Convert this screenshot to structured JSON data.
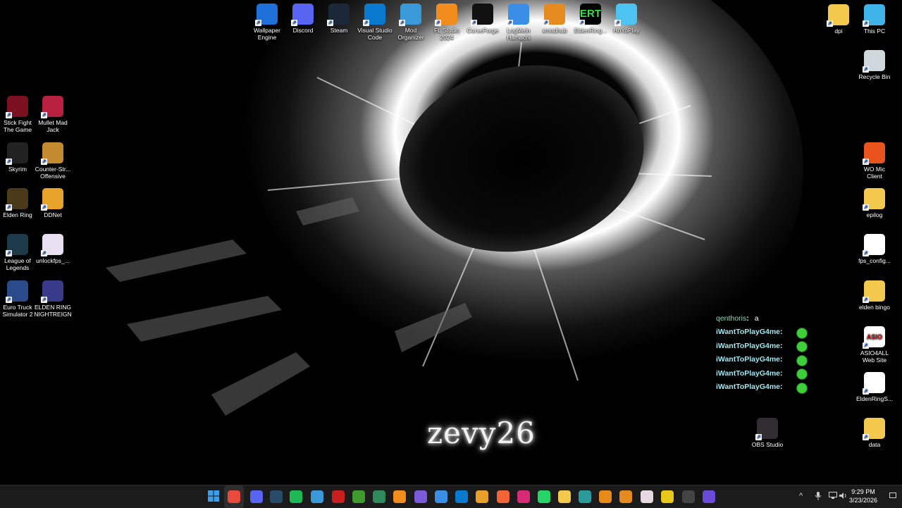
{
  "desktop": {
    "top_icons": [
      {
        "label": "Wallpaper Engine",
        "icon": "wallpaper-engine-icon",
        "color": "#1e6fd9"
      },
      {
        "label": "Discord",
        "icon": "discord-icon",
        "color": "#5865f2"
      },
      {
        "label": "Steam",
        "icon": "steam-icon",
        "color": "#1b2838"
      },
      {
        "label": "Visual Studio Code",
        "icon": "vscode-icon",
        "color": "#0a7ad1"
      },
      {
        "label": "Mod Organizer",
        "icon": "mod-organizer-icon",
        "color": "#3a9ad9"
      },
      {
        "label": "FL Studio 2024",
        "icon": "fl-studio-icon",
        "color": "#f28c1c"
      },
      {
        "label": "CurseForge",
        "icon": "curseforge-icon",
        "color": "#111111"
      },
      {
        "label": "LogMeIn Hamachi",
        "icon": "hamachi-icon",
        "color": "#3a8ee6"
      },
      {
        "label": "xmodhub",
        "icon": "xmodhub-icon",
        "color": "#e58a1f"
      },
      {
        "label": "EldenRing...",
        "icon": "ert-icon",
        "color": "#000000"
      },
      {
        "label": "HoYoPlay",
        "icon": "hoyoplay-icon",
        "color": "#4cc3f0"
      }
    ],
    "ert_text": "ERT",
    "left_icons": [
      {
        "label": "Stick Fight The Game",
        "icon": "stick-fight-icon",
        "color": "#7a1020"
      },
      {
        "label": "Mullet Mad Jack",
        "icon": "mullet-mad-jack-icon",
        "color": "#b82040"
      },
      {
        "label": "Skyrim",
        "icon": "skyrim-icon",
        "color": "#222222"
      },
      {
        "label": "Counter-Str... Offensive",
        "icon": "counter-strike-icon",
        "color": "#c48a30"
      },
      {
        "label": "Elden Ring",
        "icon": "elden-ring-icon",
        "color": "#4a3a1a"
      },
      {
        "label": "DDNet",
        "icon": "ddnet-icon",
        "color": "#e8a32a"
      },
      {
        "label": "League of Legends",
        "icon": "league-of-legends-icon",
        "color": "#1c3a4a"
      },
      {
        "label": "unlockfps_...",
        "icon": "unlockfps-icon",
        "color": "#e8e0f0"
      },
      {
        "label": "Euro Truck Simulator 2",
        "icon": "euro-truck-icon",
        "color": "#2a4a8a"
      },
      {
        "label": "ELDEN RING NIGHTREIGN",
        "icon": "nightreign-icon",
        "color": "#3a3a8a"
      }
    ],
    "right_icons": [
      {
        "label": "dpi",
        "icon": "folder-icon",
        "color": "#f2c94c"
      },
      {
        "label": "This PC",
        "icon": "monitor-icon",
        "color": "#3fb4e8"
      },
      {
        "label": "Recycle Bin",
        "icon": "recycle-bin-icon",
        "color": "#cfd8dc"
      },
      {
        "label": "WO Mic Client",
        "icon": "microphone-icon",
        "color": "#e8541c"
      },
      {
        "label": "epilog",
        "icon": "folder-icon",
        "color": "#f2c94c"
      },
      {
        "label": "fps_config...",
        "icon": "json-file-icon",
        "color": "#ffffff"
      },
      {
        "label": "elden bingo",
        "icon": "folder-icon",
        "color": "#f2c94c"
      },
      {
        "label": "ASIO4ALL Web Site",
        "icon": "asio-icon",
        "color": "#ffffff"
      },
      {
        "label": "EldenRingS...",
        "icon": "app-window-icon",
        "color": "#ffffff"
      },
      {
        "label": "OBS Studio",
        "icon": "obs-icon",
        "color": "#302e31"
      },
      {
        "label": "data",
        "icon": "folder-icon",
        "color": "#f2c94c"
      }
    ],
    "asio_text": "ASIO"
  },
  "chat": {
    "messages": [
      {
        "user": "qenthoris",
        "text": "a"
      },
      {
        "user": "iWantToPlayG4me",
        "text": ""
      },
      {
        "user": "iWantToPlayG4me",
        "text": ""
      },
      {
        "user": "iWantToPlayG4me",
        "text": ""
      },
      {
        "user": "iWantToPlayG4me",
        "text": ""
      },
      {
        "user": "iWantToPlayG4me",
        "text": ""
      }
    ],
    "colon": ":"
  },
  "streamer_name": "zevy26",
  "taskbar": {
    "apps": [
      {
        "name": "start-button",
        "icon": "windows-icon",
        "color": "#3a9ee8"
      },
      {
        "name": "taskbar-chrome",
        "icon": "chrome-icon",
        "color": "#e84a3c"
      },
      {
        "name": "taskbar-discord",
        "icon": "discord-icon",
        "color": "#5865f2"
      },
      {
        "name": "taskbar-steam",
        "icon": "steam-icon",
        "color": "#2a4a6a"
      },
      {
        "name": "taskbar-spotify",
        "icon": "spotify-icon",
        "color": "#1db954"
      },
      {
        "name": "taskbar-mod-organizer",
        "icon": "mod-organizer-icon",
        "color": "#3a9ad9"
      },
      {
        "name": "taskbar-app-red",
        "icon": "red-app-icon",
        "color": "#c81e1e"
      },
      {
        "name": "taskbar-minecraft",
        "icon": "minecraft-icon",
        "color": "#3f9a2e"
      },
      {
        "name": "taskbar-app-green",
        "icon": "green-app-icon",
        "color": "#2e8a5a"
      },
      {
        "name": "taskbar-fl-studio",
        "icon": "fl-studio-icon",
        "color": "#f28c1c"
      },
      {
        "name": "taskbar-app-purple",
        "icon": "purple-app-icon",
        "color": "#7a5ad9"
      },
      {
        "name": "taskbar-hamachi",
        "icon": "hamachi-icon",
        "color": "#3a8ee6"
      },
      {
        "name": "taskbar-vscode",
        "icon": "vscode-icon",
        "color": "#0a7ad1"
      },
      {
        "name": "taskbar-app-orange",
        "icon": "orange-app-icon",
        "color": "#e8a02a"
      },
      {
        "name": "taskbar-curseforge",
        "icon": "curseforge-icon",
        "color": "#f16436"
      },
      {
        "name": "taskbar-instagram",
        "icon": "instagram-icon",
        "color": "#d62976"
      },
      {
        "name": "taskbar-whatsapp",
        "icon": "whatsapp-icon",
        "color": "#25d366"
      },
      {
        "name": "taskbar-file-explorer",
        "icon": "folder-icon",
        "color": "#f2c94c"
      },
      {
        "name": "taskbar-app-teal",
        "icon": "teal-app-icon",
        "color": "#2a9a9a"
      },
      {
        "name": "taskbar-app-amber",
        "icon": "amber-app-icon",
        "color": "#e88a1a"
      },
      {
        "name": "taskbar-xmodhub",
        "icon": "xmodhub-icon",
        "color": "#e58a1f"
      },
      {
        "name": "taskbar-app-anime",
        "icon": "anime-app-icon",
        "color": "#e8d8e0"
      },
      {
        "name": "taskbar-app-yellow",
        "icon": "yellow-app-icon",
        "color": "#e8c81a"
      },
      {
        "name": "taskbar-obs",
        "icon": "obs-icon",
        "color": "#444444"
      },
      {
        "name": "taskbar-app-violet",
        "icon": "violet-app-icon",
        "color": "#6a4ad9"
      }
    ],
    "tray": {
      "chevron": "^",
      "time": "9:29 PM",
      "date": "3/23/2026"
    }
  }
}
